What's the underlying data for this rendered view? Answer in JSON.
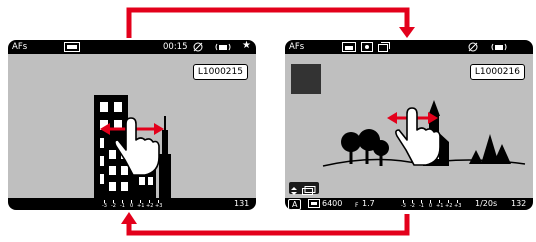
{
  "left_screen": {
    "af_mode": "AFs",
    "time": "00:15",
    "wifi_icon": "wireless-transfer-icon",
    "battery_icon": "battery-icon",
    "star": "★",
    "filename": "L1000215",
    "frame_count": "131",
    "exposure_scale": [
      "-3",
      "-2",
      "-1",
      "0",
      "+1",
      "+2",
      "+3"
    ]
  },
  "right_screen": {
    "af_mode": "AFs",
    "filename": "L1000216",
    "mode": "A",
    "iso": "6400",
    "aperture_prefix": "F",
    "aperture": "1.7",
    "shutter": "1/20s",
    "frame_count": "132",
    "exposure_scale": [
      "-3",
      "-2",
      "-1",
      "0",
      "+1",
      "+2",
      "+3"
    ]
  },
  "colors": {
    "arrow": "#e3001b",
    "screen_bg": "#000000",
    "viewfinder": "#bfbfbf"
  }
}
